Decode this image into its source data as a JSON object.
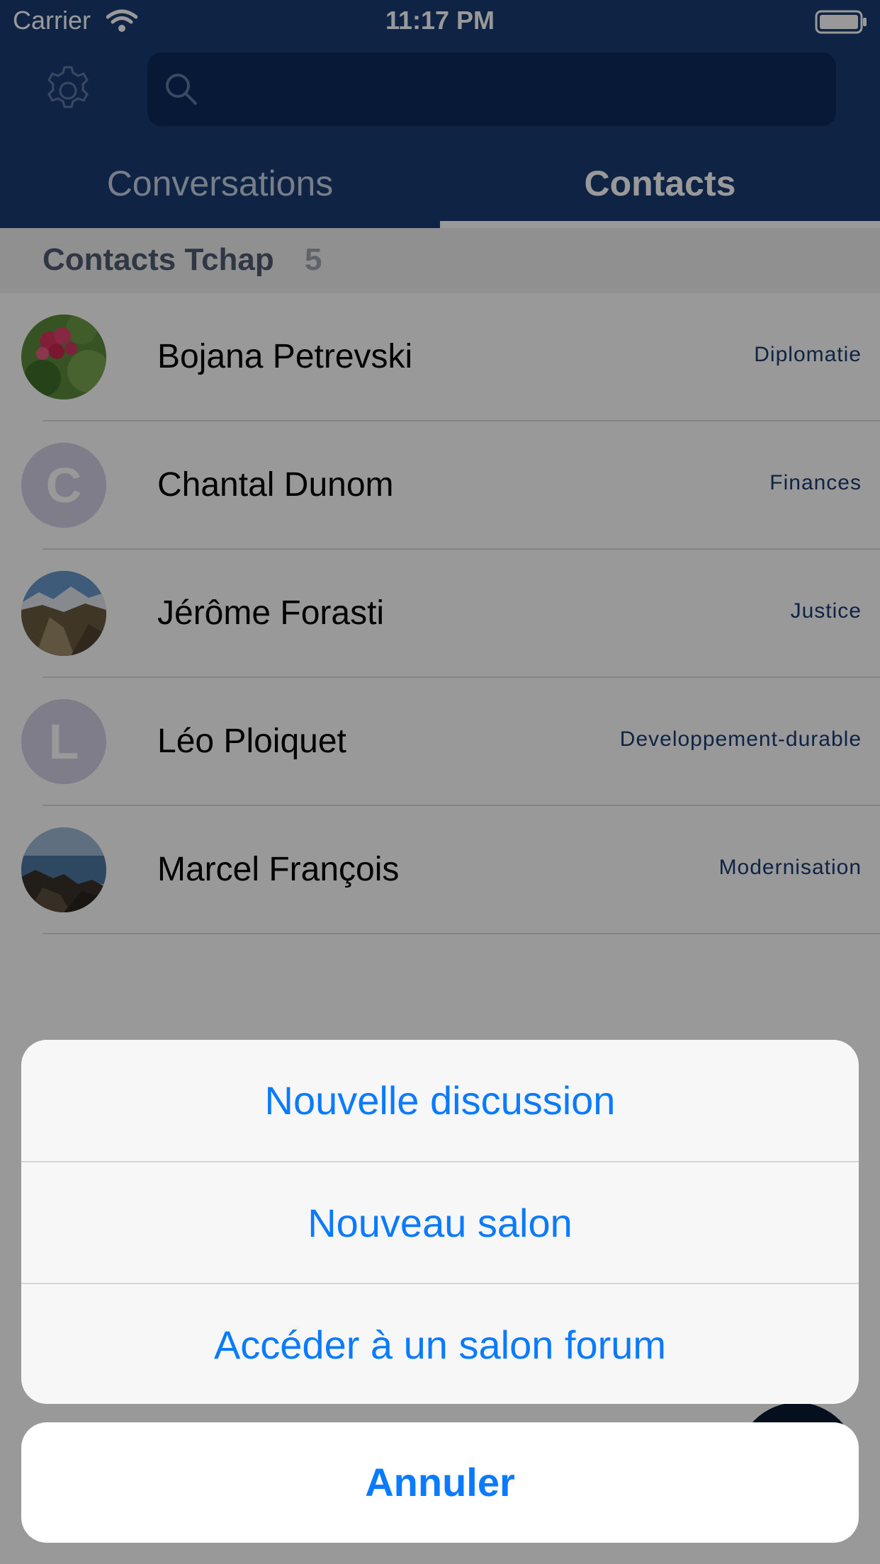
{
  "status_bar": {
    "carrier": "Carrier",
    "time": "11:17 PM"
  },
  "search": {
    "placeholder": ""
  },
  "tabs": [
    {
      "label": "Conversations",
      "selected": false
    },
    {
      "label": "Contacts",
      "selected": true
    }
  ],
  "section": {
    "title": "Contacts Tchap",
    "count": "5"
  },
  "contacts": [
    {
      "name": "Bojana Petrevski",
      "department": "Diplomatie",
      "avatar_type": "photo",
      "avatar_icon": "flower-photo"
    },
    {
      "name": "Chantal Dunom",
      "department": "Finances",
      "avatar_type": "letter",
      "avatar_letter": "C"
    },
    {
      "name": "Jérôme Forasti",
      "department": "Justice",
      "avatar_type": "photo",
      "avatar_icon": "mountain-photo"
    },
    {
      "name": "Léo Ploiquet",
      "department": "Developpement-durable",
      "avatar_type": "letter",
      "avatar_letter": "L"
    },
    {
      "name": "Marcel François",
      "department": "Modernisation",
      "avatar_type": "photo",
      "avatar_icon": "seashore-photo"
    }
  ],
  "action_sheet": {
    "items": [
      "Nouvelle discussion",
      "Nouveau salon",
      "Accéder à un salon forum"
    ],
    "cancel_label": "Annuler"
  },
  "colors": {
    "header": "#1a3b73",
    "accent_blue": "#0a7aff",
    "department_text": "#1a3b73",
    "letter_avatar": "#d3d1e5"
  }
}
